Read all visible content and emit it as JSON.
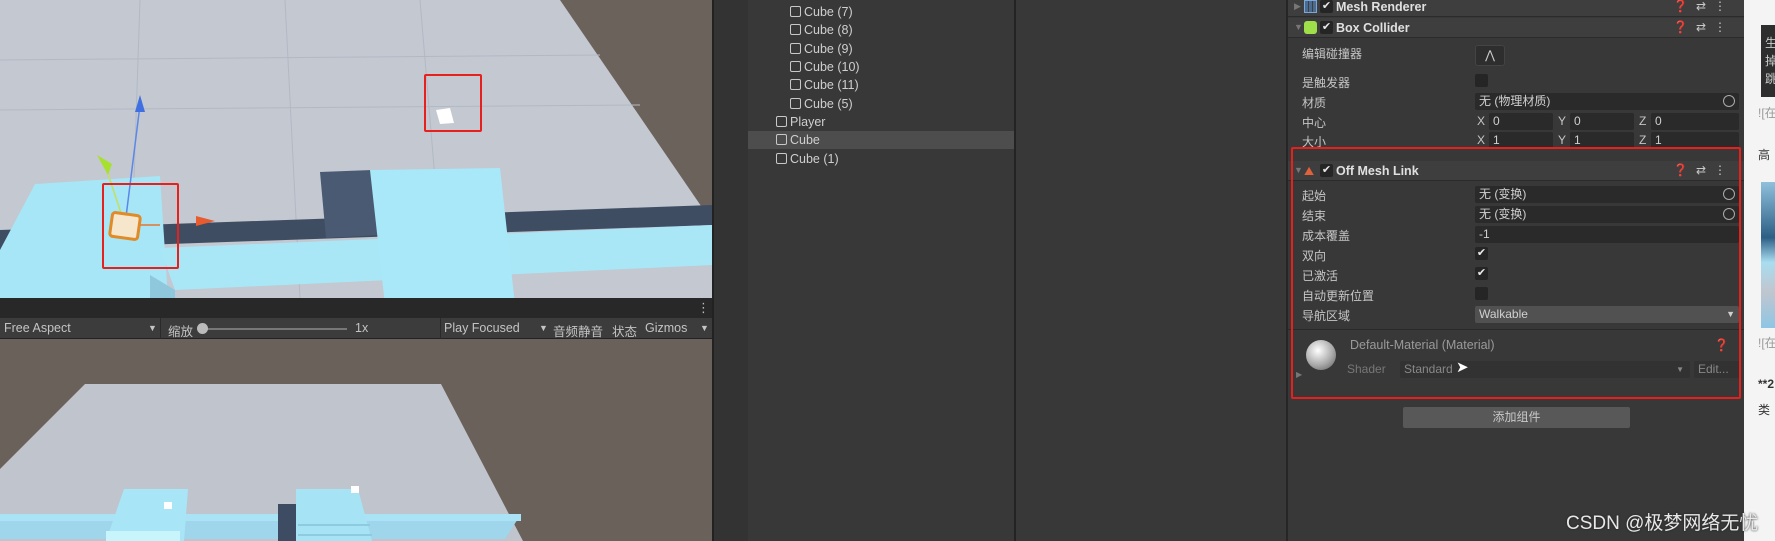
{
  "toolbar": {
    "aspect": "Free Aspect",
    "scale_label": "缩放",
    "scale_value": "1x",
    "scale_fraction": 0,
    "play_mode": "Play Focused",
    "mute": "音频静音",
    "stats": "状态",
    "gizmos": "Gizmos"
  },
  "hierarchy": {
    "items": [
      {
        "label": "Cube (7)",
        "depth": 1
      },
      {
        "label": "Cube (8)",
        "depth": 1
      },
      {
        "label": "Cube (9)",
        "depth": 1
      },
      {
        "label": "Cube (10)",
        "depth": 1
      },
      {
        "label": "Cube (11)",
        "depth": 1
      },
      {
        "label": "Cube (5)",
        "depth": 1
      },
      {
        "label": "Player",
        "depth": 0
      },
      {
        "label": "Cube",
        "depth": 0,
        "selected": true
      },
      {
        "label": "Cube (1)",
        "depth": 0
      }
    ]
  },
  "inspector": {
    "mesh_renderer": {
      "title": "Mesh Renderer",
      "enabled": true
    },
    "box_collider": {
      "title": "Box Collider",
      "enabled": true,
      "edit_collider": "编辑碰撞器",
      "is_trigger": "是触发器",
      "is_trigger_value": false,
      "material": "材质",
      "material_value": "无 (物理材质)",
      "center": "中心",
      "center_value": {
        "x": "0",
        "y": "0",
        "z": "0"
      },
      "size": "大小",
      "size_value": {
        "x": "1",
        "y": "1",
        "z": "1"
      }
    },
    "off_mesh_link": {
      "title": "Off Mesh Link",
      "enabled": true,
      "start": "起始",
      "start_value": "无 (变换)",
      "end": "结束",
      "end_value": "无 (变换)",
      "cost": "成本覆盖",
      "cost_value": "-1",
      "bidirectional": "双向",
      "bidirectional_value": true,
      "activated": "已激活",
      "activated_value": true,
      "auto_update": "自动更新位置",
      "auto_update_value": false,
      "area": "导航区域",
      "area_value": "Walkable"
    },
    "material": {
      "name": "Default-Material (Material)",
      "shader_label": "Shader",
      "shader_value": "Standard",
      "edit": "Edit..."
    },
    "add_component": "添加组件"
  },
  "axis_labels": {
    "x": "X",
    "y": "Y",
    "z": "Z"
  },
  "right_page": {
    "l1": "生",
    "l2": "掉",
    "l3": "跳",
    "alt1": "![在",
    "t1": "高",
    "alt2": "![在",
    "t2": "**2",
    "t3": "类"
  },
  "watermark": "CSDN @极梦网络无忧",
  "colors": {
    "highlight": "#e8201d",
    "cube": "#a8e6f6",
    "floor": "#c3c8d1",
    "bg": "#383838"
  }
}
